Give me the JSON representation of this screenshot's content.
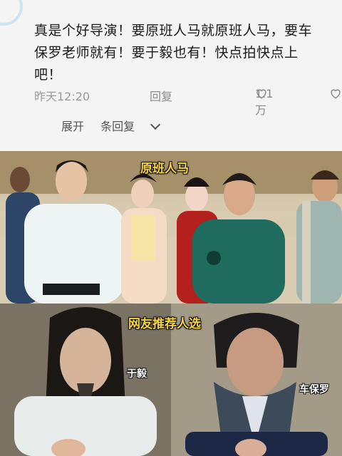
{
  "comment": {
    "lines": [
      "真是个好导演！要原班人马就原班人马，要车",
      "保罗老师就有！要于毅也有！快点拍快点上",
      "吧！"
    ],
    "time": "昨天12:20",
    "reply_label": "回复",
    "like_count": "1.1万",
    "expand_label": "展开",
    "replies_label": "条回复"
  },
  "images": {
    "top_caption": "原班人马",
    "bottom_caption": "网友推荐人选",
    "left_name": "于毅",
    "right_name": "车保罗"
  },
  "colors": {
    "caption": "#f7d43a",
    "meta_gray": "#9a9a9a",
    "avatar_ring": "#cfe3f7"
  }
}
